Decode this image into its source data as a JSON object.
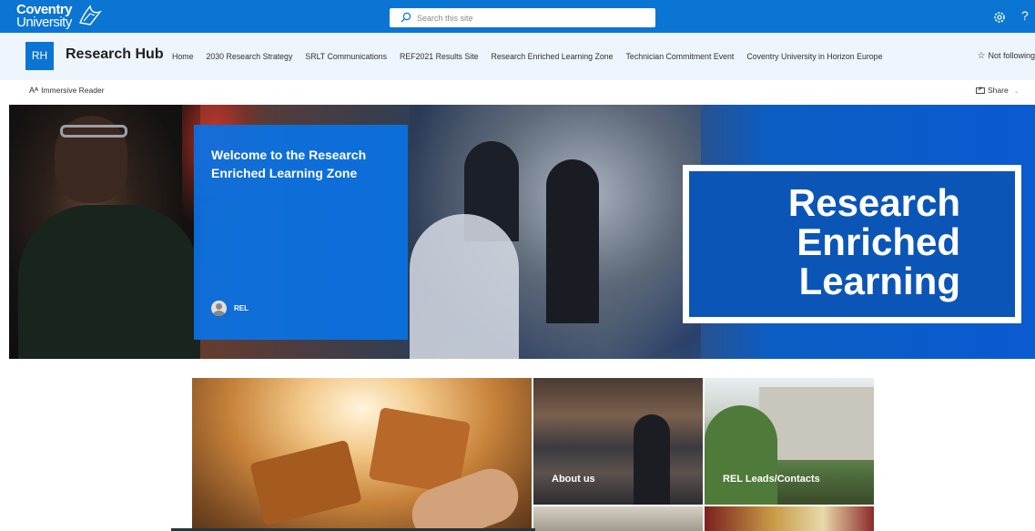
{
  "suite_bar": {
    "logo_line1": "Coventry",
    "logo_line2": "University",
    "search_placeholder": "Search this site",
    "settings_icon": "gear-icon",
    "help_label": "?",
    "accent_color": "#0b75d4"
  },
  "site_header": {
    "initials": "RH",
    "title": "Research Hub",
    "nav": [
      "Home",
      "2030 Research Strategy",
      "SRLT Communications",
      "REF2021 Results Site",
      "Research Enriched Learning Zone",
      "Technician Commitment Event",
      "Coventry University in Horizon Europe"
    ],
    "follow_label": "Not following"
  },
  "command_bar": {
    "immersive_reader": "Immersive Reader",
    "share": "Share"
  },
  "hero": {
    "welcome_title": "Welcome to the Research Enriched Learning Zone",
    "author": "REL",
    "banner_line1": "Research",
    "banner_line2": "Enriched",
    "banner_line3": "Learning"
  },
  "tiles": {
    "about": "About us",
    "leads": "REL Leads/Contacts"
  }
}
